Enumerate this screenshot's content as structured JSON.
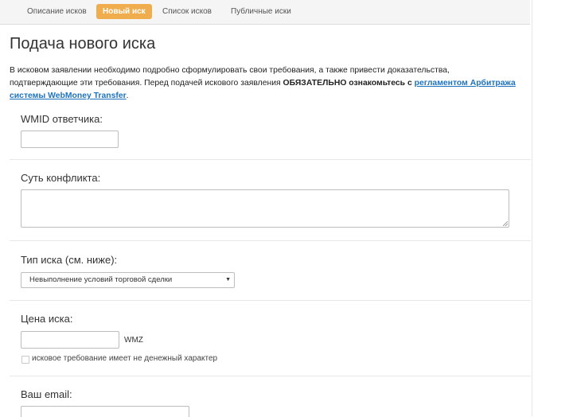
{
  "nav": {
    "items": [
      {
        "label": "Описание исков",
        "active": false
      },
      {
        "label": "Новый иск",
        "active": true
      },
      {
        "label": "Список исков",
        "active": false
      },
      {
        "label": "Публичные иски",
        "active": false
      }
    ]
  },
  "page": {
    "title": "Подача нового иска",
    "intro": {
      "text1": "В исковом заявлении необходимо подробно сформулировать свои требования, а также привести доказательства, подтверждающие эти требования. Перед подачей искового заявления ",
      "bold": "ОБЯЗАТЕЛЬНО ознакомьтесь с",
      "link": "регламентом Арбитража системы WebMoney Transfer",
      "end": "."
    }
  },
  "form": {
    "wmid_label": "WMID ответчика:",
    "wmid_value": "",
    "conflict_label": "Суть конфликта:",
    "conflict_value": "",
    "type_label": "Тип иска (см. ниже):",
    "type_selected": "Невыполнение условий торговой сделки",
    "price_label": "Цена иска:",
    "price_value": "",
    "price_unit": "WMZ",
    "nonmonetary_label": "исковое требование имеет не денежный характер",
    "nonmonetary_checked": false,
    "email_label": "Ваш email:",
    "email_value": ""
  },
  "colors": {
    "accent": "#f0ad4e",
    "link": "#1e73be"
  }
}
